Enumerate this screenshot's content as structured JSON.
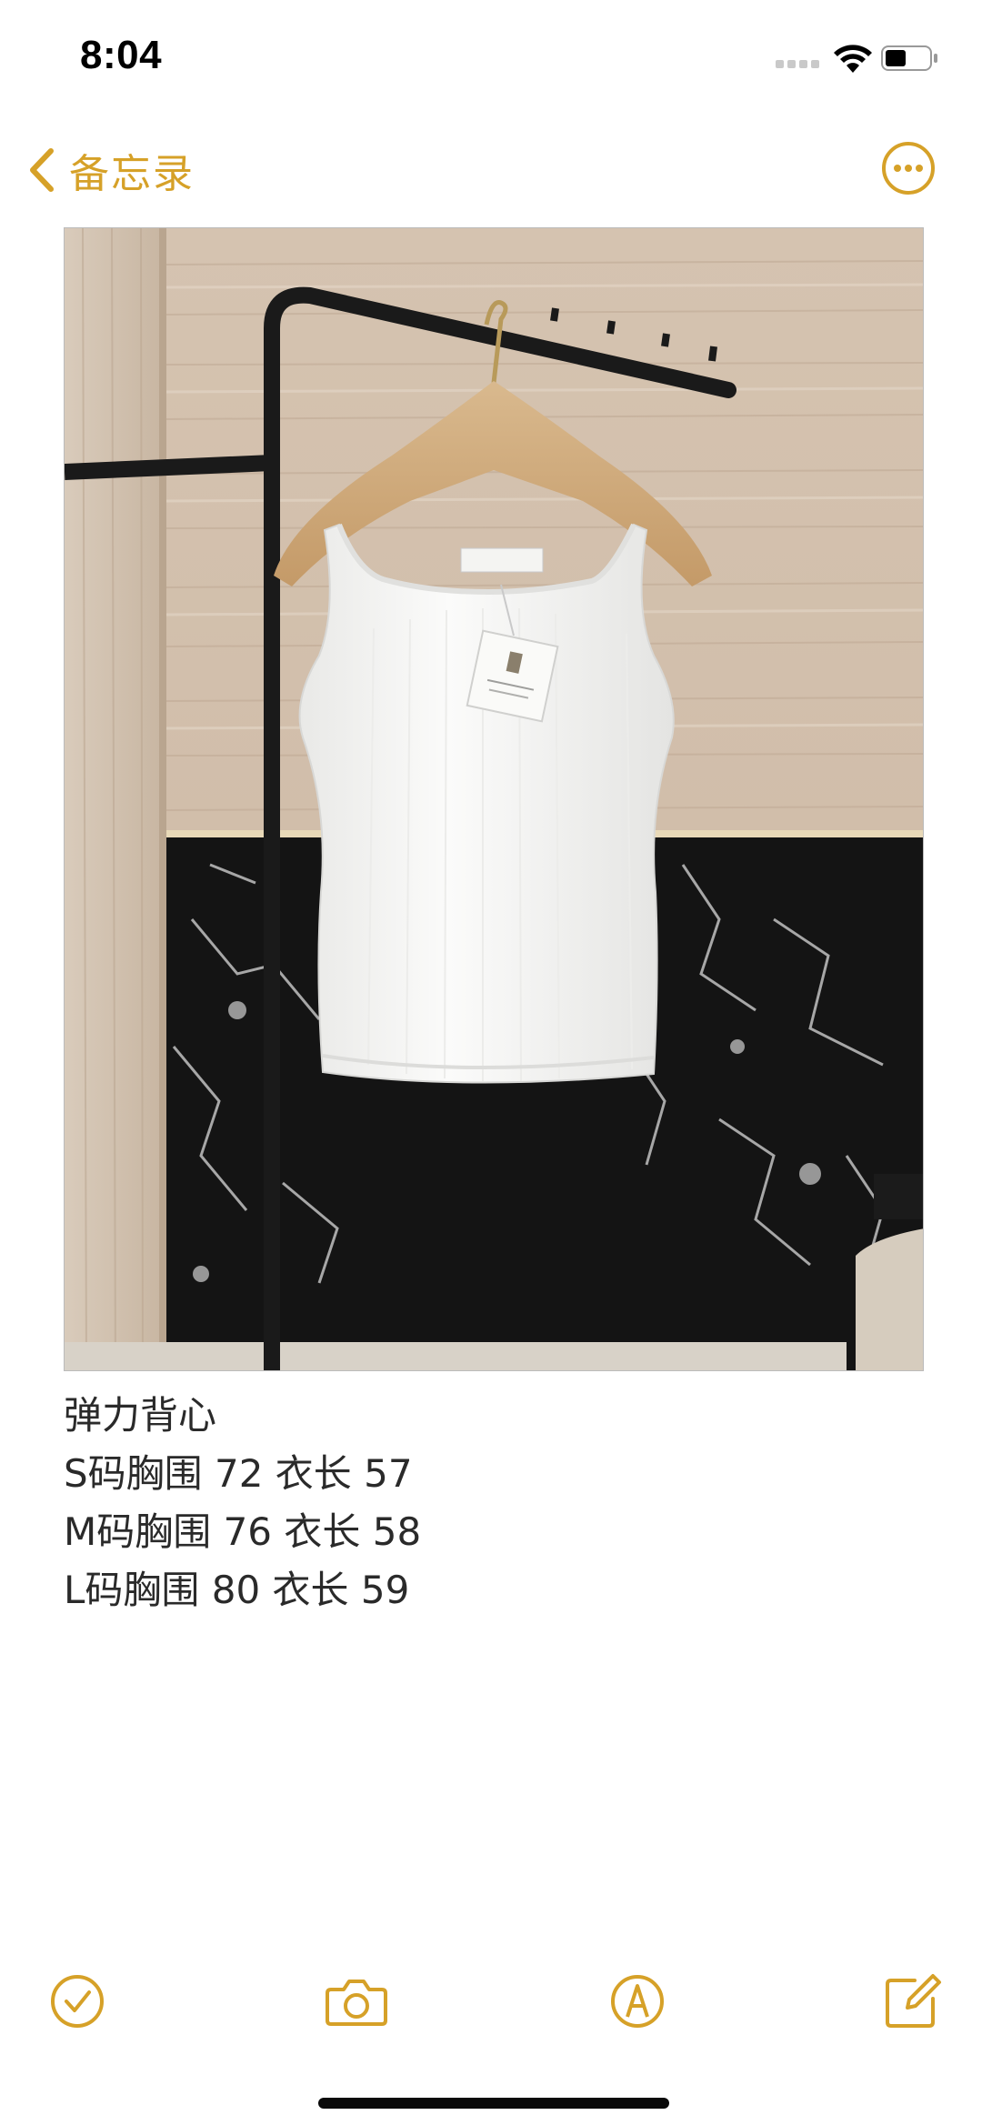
{
  "status_bar": {
    "time": "8:04",
    "icons": [
      "signal-icon",
      "wifi-icon",
      "battery-icon"
    ]
  },
  "nav": {
    "back_label": "备忘录",
    "back_icon": "chevron-left-icon",
    "more_icon": "ellipsis-circle-icon"
  },
  "note": {
    "image_description_icon": "photo",
    "lines": [
      "弹力背心",
      "S码胸围 72 衣长 57",
      "M码胸围 76 衣长 58",
      "L码胸围 80 衣长 59"
    ]
  },
  "toolbar": {
    "icons": [
      "checklist-icon",
      "camera-icon",
      "markup-pen-icon",
      "compose-icon"
    ]
  },
  "colors": {
    "accent": "#d6a128",
    "text": "#2a2a2a",
    "background": "#ffffff"
  }
}
